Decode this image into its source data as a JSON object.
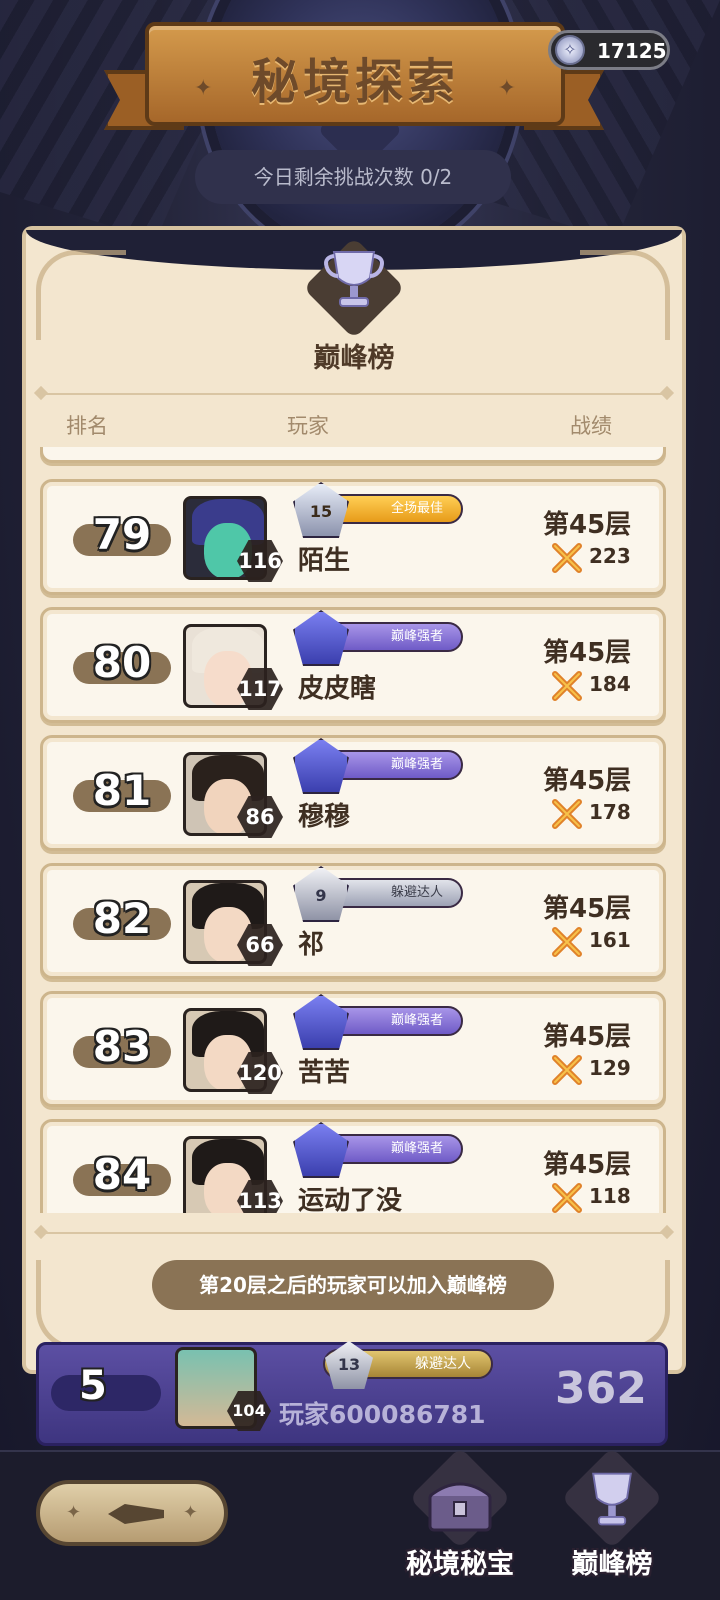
{
  "header": {
    "title": "秘境探索",
    "currency_value": "17125",
    "attempts_text": "今日剩余挑战次数 0/2"
  },
  "panel": {
    "heading": "巅峰榜",
    "columns": {
      "rank": "排名",
      "player": "玩家",
      "record": "战绩"
    },
    "rows": [
      {
        "rank": "79",
        "level": "116",
        "name": "陌生",
        "title": "全场最佳",
        "emblem_num": "15",
        "badge": "gold",
        "floor": "第45层",
        "score": "223"
      },
      {
        "rank": "80",
        "level": "117",
        "name": "皮皮瞎",
        "title": "巅峰强者",
        "emblem_num": "",
        "badge": "purple",
        "floor": "第45层",
        "score": "184"
      },
      {
        "rank": "81",
        "level": "86",
        "name": "穆穆",
        "title": "巅峰强者",
        "emblem_num": "",
        "badge": "purple",
        "floor": "第45层",
        "score": "178"
      },
      {
        "rank": "82",
        "level": "66",
        "name": "祁",
        "title": "躲避达人",
        "emblem_num": "9",
        "badge": "silver",
        "floor": "第45层",
        "score": "161"
      },
      {
        "rank": "83",
        "level": "120",
        "name": "苦苦",
        "title": "巅峰强者",
        "emblem_num": "",
        "badge": "purple",
        "floor": "第45层",
        "score": "129"
      },
      {
        "rank": "84",
        "level": "113",
        "name": "运动了没",
        "title": "巅峰强者",
        "emblem_num": "",
        "badge": "purple",
        "floor": "第45层",
        "score": "118"
      }
    ],
    "join_info": "第20层之后的玩家可以加入巅峰榜"
  },
  "my_rank": {
    "rank": "5",
    "level": "104",
    "name": "玩家600086781",
    "title": "躲避达人",
    "emblem_num": "13",
    "score": "362"
  },
  "bottom_nav": {
    "treasure_label": "秘境秘宝",
    "leaderboard_label": "巅峰榜"
  },
  "colors": {
    "parchment": "#f3e6cf",
    "rank_pill": "#8a7355",
    "my_bar": "#4a4190"
  }
}
